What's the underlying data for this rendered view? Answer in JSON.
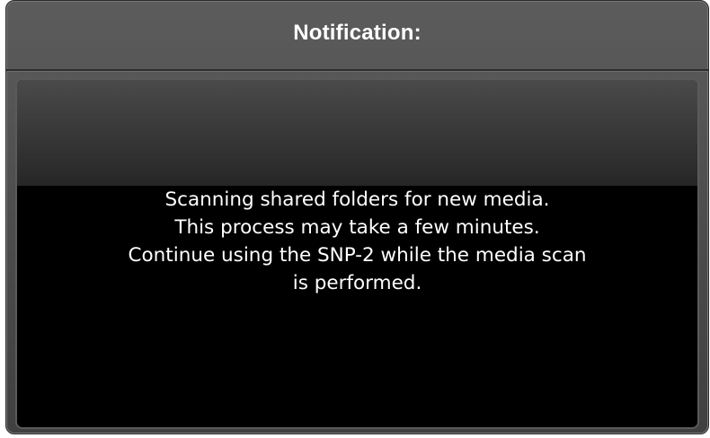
{
  "dialog": {
    "title": "Notification:",
    "message_lines": [
      "Scanning shared folders for new media.",
      "This process may take a few minutes.",
      "Continue using the SNP-2 while the media scan",
      "is performed."
    ]
  },
  "colors": {
    "title_text": "#ffffff",
    "dialog_frame": "#4a4a4a",
    "content_background": "#000000",
    "message_text": "#ffffff"
  }
}
